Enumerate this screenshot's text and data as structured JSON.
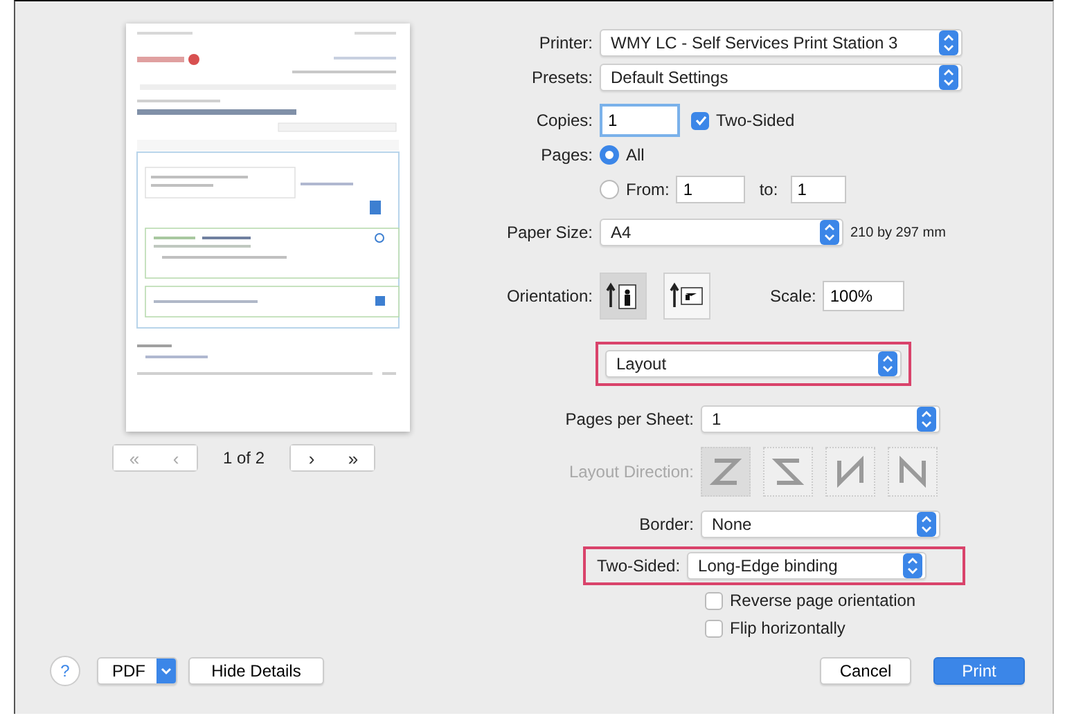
{
  "preview": {
    "nav_back": [
      "«",
      "‹"
    ],
    "page_indicator": "1 of 2",
    "nav_forward": [
      "›",
      "»"
    ]
  },
  "printer": {
    "label": "Printer:",
    "value": "WMY LC - Self Services Print Station 3"
  },
  "presets": {
    "label": "Presets:",
    "value": "Default Settings"
  },
  "copies": {
    "label": "Copies:",
    "value": "1",
    "focused": true,
    "two_sided": {
      "label": "Two-Sided",
      "checked": true
    }
  },
  "pages": {
    "label": "Pages:",
    "options": [
      {
        "label": "All",
        "selected": true
      },
      {
        "label": "From:",
        "selected": false
      }
    ],
    "from": "1",
    "to_label": "to:",
    "to": "1"
  },
  "paper_size": {
    "label": "Paper Size:",
    "value": "A4",
    "dimensions": "210 by 297 mm"
  },
  "orientation": {
    "label": "Orientation:",
    "options": [
      {
        "kind": "portrait",
        "selected": true
      },
      {
        "kind": "landscape",
        "selected": false
      }
    ]
  },
  "scale": {
    "label": "Scale:",
    "value": "100%"
  },
  "section": {
    "value": "Layout",
    "highlighted": true
  },
  "pages_per_sheet": {
    "label": "Pages per Sheet:",
    "value": "1"
  },
  "layout_direction": {
    "label": "Layout Direction:",
    "disabled": true,
    "options": [
      {
        "kind": "z",
        "selected": true
      },
      {
        "kind": "s",
        "selected": false
      },
      {
        "kind": "reverse-n",
        "selected": false
      },
      {
        "kind": "n",
        "selected": false
      }
    ]
  },
  "border": {
    "label": "Border:",
    "value": "None"
  },
  "two_sided": {
    "label": "Two-Sided:",
    "value": "Long-Edge binding",
    "highlighted": true
  },
  "options": [
    {
      "label": "Reverse page orientation",
      "checked": false
    },
    {
      "label": "Flip horizontally",
      "checked": false
    }
  ],
  "footer": {
    "help": "?",
    "pdf": "PDF",
    "hide_details": "Hide Details",
    "cancel": "Cancel",
    "print": "Print"
  }
}
